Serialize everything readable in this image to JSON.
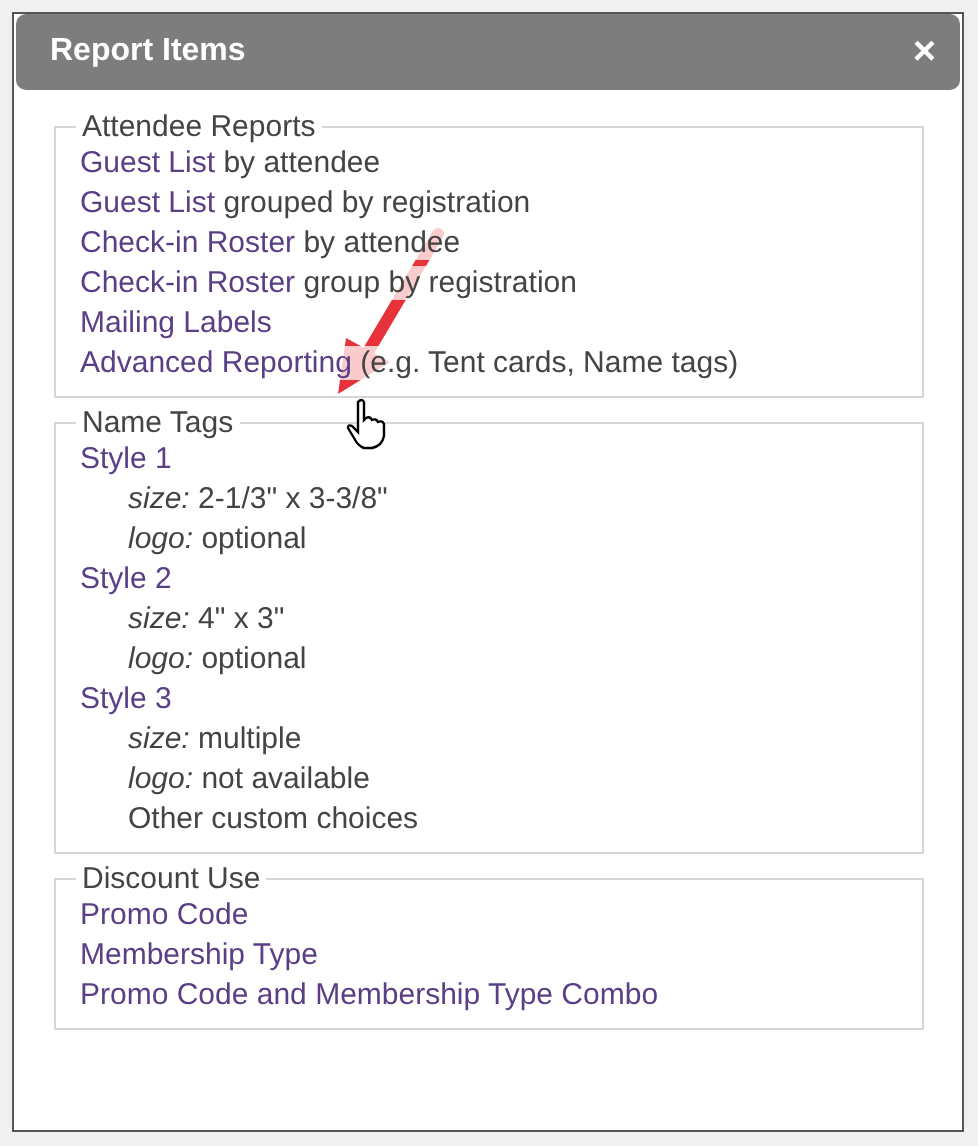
{
  "dialog": {
    "title": "Report Items",
    "close": "×"
  },
  "sections": [
    {
      "legend": "Attendee Reports",
      "items": [
        {
          "kind": "link",
          "link": "Guest List",
          "rest": " by attendee"
        },
        {
          "kind": "link",
          "link": "Guest List",
          "rest": " grouped by registration"
        },
        {
          "kind": "link",
          "link": "Check-in Roster",
          "rest": " by attendee"
        },
        {
          "kind": "link",
          "link": "Check-in Roster",
          "rest": " group by registration"
        },
        {
          "kind": "link",
          "link": "Mailing Labels"
        },
        {
          "kind": "link",
          "link": "Advanced Reporting",
          "rest": " (e.g. Tent cards, Name tags)"
        }
      ]
    },
    {
      "legend": "Name Tags",
      "items": [
        {
          "kind": "link",
          "link": "Style 1"
        },
        {
          "kind": "detail",
          "text": "*size:* 2-1/3\" x 3-3/8\""
        },
        {
          "kind": "detail",
          "text": "*logo:* optional"
        },
        {
          "kind": "link",
          "link": "Style 2"
        },
        {
          "kind": "detail",
          "text": "*size:* 4\" x 3\""
        },
        {
          "kind": "detail",
          "text": "*logo:* optional"
        },
        {
          "kind": "link",
          "link": "Style 3"
        },
        {
          "kind": "detail",
          "text": "*size:* multiple"
        },
        {
          "kind": "detail",
          "text": "*logo:* not available"
        },
        {
          "kind": "detail",
          "text": "Other custom choices"
        }
      ]
    },
    {
      "legend": "Discount Use",
      "items": [
        {
          "kind": "link",
          "link": "Promo Code"
        },
        {
          "kind": "link",
          "link": "Membership Type"
        },
        {
          "kind": "link",
          "link": "Promo Code and Membership Type Combo"
        }
      ]
    }
  ]
}
